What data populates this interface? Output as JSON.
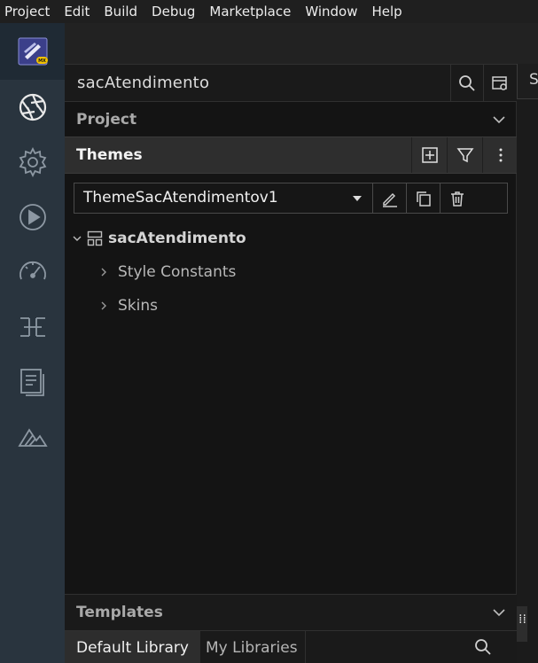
{
  "menubar": {
    "items": [
      "Project",
      "Edit",
      "Build",
      "Debug",
      "Marketplace",
      "Window",
      "Help"
    ]
  },
  "activity_bar": {
    "logo_badge": "MX",
    "items": [
      "aperture-icon",
      "gear-icon",
      "play-icon",
      "gauge-icon",
      "layout-icon",
      "document-icon",
      "mountain-icon"
    ]
  },
  "panel": {
    "project_name": "sacAtendimento",
    "project_section": "Project",
    "themes_section": "Themes",
    "selected_theme": "ThemeSacAtendimentov1",
    "tree": {
      "root": "sacAtendimento",
      "children": [
        "Style Constants",
        "Skins"
      ]
    },
    "templates_section": "Templates",
    "library_tabs": [
      "Default Library",
      "My Libraries"
    ]
  },
  "right_panel": {
    "tab_label": "S"
  },
  "colors": {
    "activity_bar": "#29343e",
    "panel_bg": "#141414",
    "header_bg": "#2e2e2e"
  }
}
